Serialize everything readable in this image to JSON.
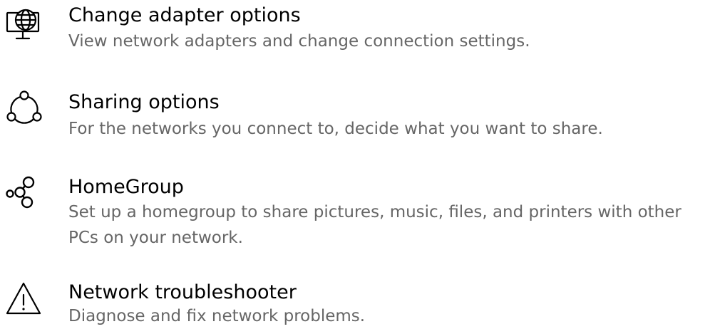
{
  "items": [
    {
      "icon": "globe-monitor-icon",
      "title": "Change adapter options",
      "description": "View network adapters and change connection settings."
    },
    {
      "icon": "sharing-circle-icon",
      "title": "Sharing options",
      "description": "For the networks you connect to, decide what you want to share."
    },
    {
      "icon": "homegroup-icon",
      "title": "HomeGroup",
      "description": "Set up a homegroup to share pictures, music, files, and printers with other PCs on your network."
    },
    {
      "icon": "warning-icon",
      "title": "Network troubleshooter",
      "description": "Diagnose and fix network problems."
    }
  ],
  "colors": {
    "title": "#000000",
    "description": "#666666",
    "background": "#ffffff"
  }
}
